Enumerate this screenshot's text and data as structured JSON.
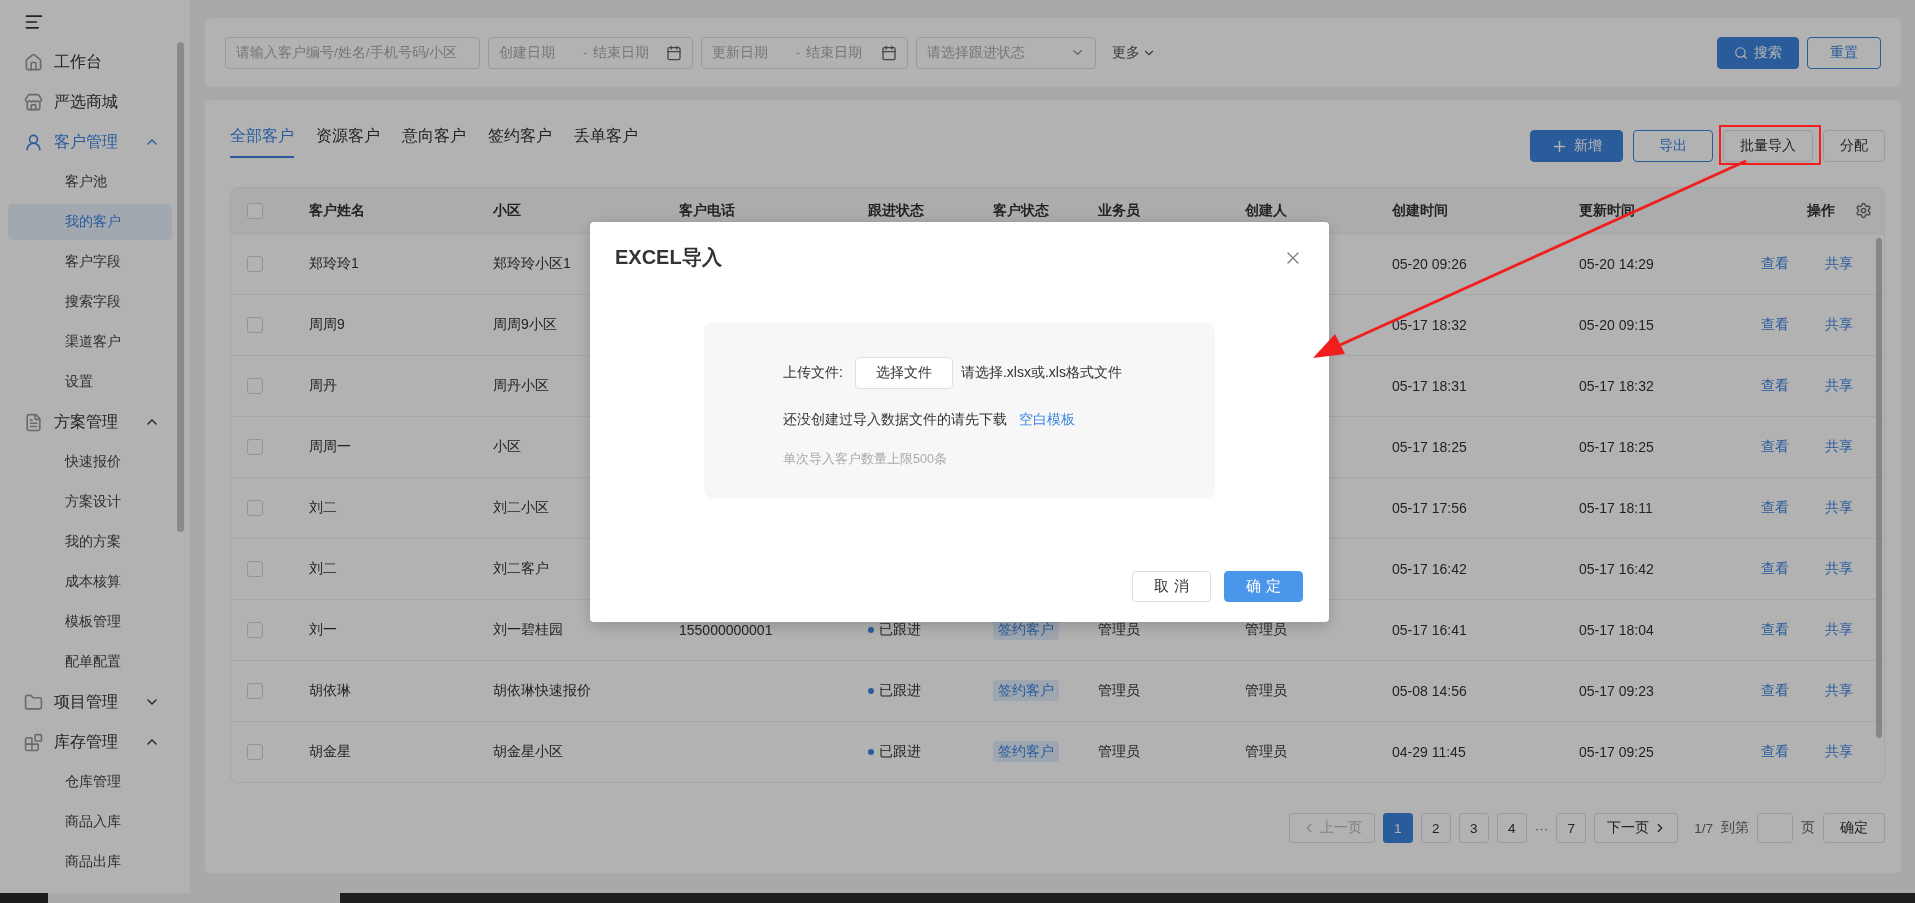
{
  "sidebar": {
    "items": [
      {
        "label": "工作台",
        "active": false
      },
      {
        "label": "严选商城",
        "active": false
      },
      {
        "label": "客户管理",
        "active": true,
        "expanded": true,
        "children": [
          {
            "label": "客户池",
            "selected": false
          },
          {
            "label": "我的客户",
            "selected": true
          },
          {
            "label": "客户字段",
            "selected": false
          },
          {
            "label": "搜索字段",
            "selected": false
          },
          {
            "label": "渠道客户",
            "selected": false
          },
          {
            "label": "设置",
            "selected": false
          }
        ]
      },
      {
        "label": "方案管理",
        "active": false,
        "expanded": true,
        "children": [
          {
            "label": "快速报价",
            "selected": false
          },
          {
            "label": "方案设计",
            "selected": false
          },
          {
            "label": "我的方案",
            "selected": false
          },
          {
            "label": "成本核算",
            "selected": false
          },
          {
            "label": "模板管理",
            "selected": false
          },
          {
            "label": "配单配置",
            "selected": false
          }
        ]
      },
      {
        "label": "项目管理",
        "active": false,
        "expanded": false
      },
      {
        "label": "库存管理",
        "active": false,
        "expanded": true,
        "children": [
          {
            "label": "仓库管理",
            "selected": false
          },
          {
            "label": "商品入库",
            "selected": false
          },
          {
            "label": "商品出库",
            "selected": false
          }
        ]
      }
    ]
  },
  "filters": {
    "search": {
      "placeholder": "请输入客户编号/姓名/手机号码/小区"
    },
    "created_range": {
      "start_placeholder": "创建日期",
      "separator": "-",
      "end_placeholder": "结束日期"
    },
    "updated_range": {
      "start_placeholder": "更新日期",
      "separator": "-",
      "end_placeholder": "结束日期"
    },
    "follow_select": {
      "placeholder": "请选择跟进状态"
    },
    "more": "更多",
    "search_button": "搜索",
    "reset_button": "重置"
  },
  "tabs": [
    {
      "label": "全部客户",
      "selected": true
    },
    {
      "label": "资源客户",
      "selected": false
    },
    {
      "label": "意向客户",
      "selected": false
    },
    {
      "label": "签约客户",
      "selected": false
    },
    {
      "label": "丢单客户",
      "selected": false
    }
  ],
  "actions": [
    {
      "label": "新增",
      "kind": "primary",
      "highlighted": false
    },
    {
      "label": "导出",
      "kind": "outline",
      "highlighted": false
    },
    {
      "label": "批量导入",
      "kind": "default",
      "highlighted": true
    },
    {
      "label": "分配",
      "kind": "default",
      "highlighted": false
    }
  ],
  "table": {
    "header_checked": false,
    "columns": [
      "客户姓名",
      "小区",
      "客户电话",
      "跟进状态",
      "客户状态",
      "业务员",
      "创建人",
      "创建时间",
      "更新时间",
      "操作"
    ],
    "rows": [
      {
        "checked": false,
        "name": "郑玲玲1",
        "community": "郑玲玲小区1",
        "created": "05-20 09:26",
        "updated": "05-20 14:29",
        "actions": [
          "查看",
          "共享"
        ]
      },
      {
        "checked": false,
        "name": "周周9",
        "community": "周周9小区",
        "created": "05-17 18:32",
        "updated": "05-20 09:15",
        "actions": [
          "查看",
          "共享"
        ]
      },
      {
        "checked": false,
        "name": "周丹",
        "community": "周丹小区",
        "created": "05-17 18:31",
        "updated": "05-17 18:32",
        "actions": [
          "查看",
          "共享"
        ]
      },
      {
        "checked": false,
        "name": "周周一",
        "community": "小区",
        "created": "05-17 18:25",
        "updated": "05-17 18:25",
        "actions": [
          "查看",
          "共享"
        ]
      },
      {
        "checked": false,
        "name": "刘二",
        "community": "刘二小区",
        "created": "05-17 17:56",
        "updated": "05-17 18:11",
        "actions": [
          "查看",
          "共享"
        ]
      },
      {
        "checked": false,
        "name": "刘二",
        "community": "刘二客户",
        "created": "05-17 16:42",
        "updated": "05-17 16:42",
        "actions": [
          "查看",
          "共享"
        ]
      },
      {
        "checked": false,
        "name": "刘一",
        "community": "刘一碧桂园",
        "phone": "155000000001",
        "follow": "已跟进",
        "status": "签约客户",
        "sales": "管理员",
        "creator": "管理员",
        "created": "05-17 16:41",
        "updated": "05-17 18:04",
        "actions": [
          "查看",
          "共享"
        ]
      },
      {
        "checked": false,
        "name": "胡依琳",
        "community": "胡依琳快速报价",
        "follow": "已跟进",
        "status": "签约客户",
        "sales": "管理员",
        "creator": "管理员",
        "created": "05-08 14:56",
        "updated": "05-17 09:23",
        "actions": [
          "查看",
          "共享"
        ]
      },
      {
        "checked": false,
        "name": "胡金星",
        "community": "胡金星小区",
        "follow": "已跟进",
        "status": "签约客户",
        "sales": "管理员",
        "creator": "管理员",
        "created": "04-29 11:45",
        "updated": "05-17 09:25",
        "actions": [
          "查看",
          "共享"
        ]
      }
    ]
  },
  "pagination": {
    "prev": {
      "label": "上一页",
      "disabled": true
    },
    "pages": [
      {
        "label": "1",
        "kind": "page",
        "selected": true
      },
      {
        "label": "2",
        "kind": "page",
        "selected": false
      },
      {
        "label": "3",
        "kind": "page",
        "selected": false
      },
      {
        "label": "4",
        "kind": "page",
        "selected": false
      },
      {
        "label": "···",
        "kind": "ellipsis"
      },
      {
        "label": "7",
        "kind": "page",
        "selected": false
      }
    ],
    "next": {
      "label": "下一页",
      "disabled": false
    },
    "summary": "1/7",
    "goto_label": "到第",
    "page_suffix": "页",
    "confirm": "确定"
  },
  "modal": {
    "title": "EXCEL导入",
    "upload_label": "上传文件:",
    "choose_button": "选择文件",
    "file_hint": "请选择.xlsx或.xls格式文件",
    "download_text": "还没创建过导入数据文件的请先下载",
    "template_link": "空白模板",
    "limit_note": "单次导入客户数量上限500条",
    "cancel": "取 消",
    "ok": "确 定"
  }
}
